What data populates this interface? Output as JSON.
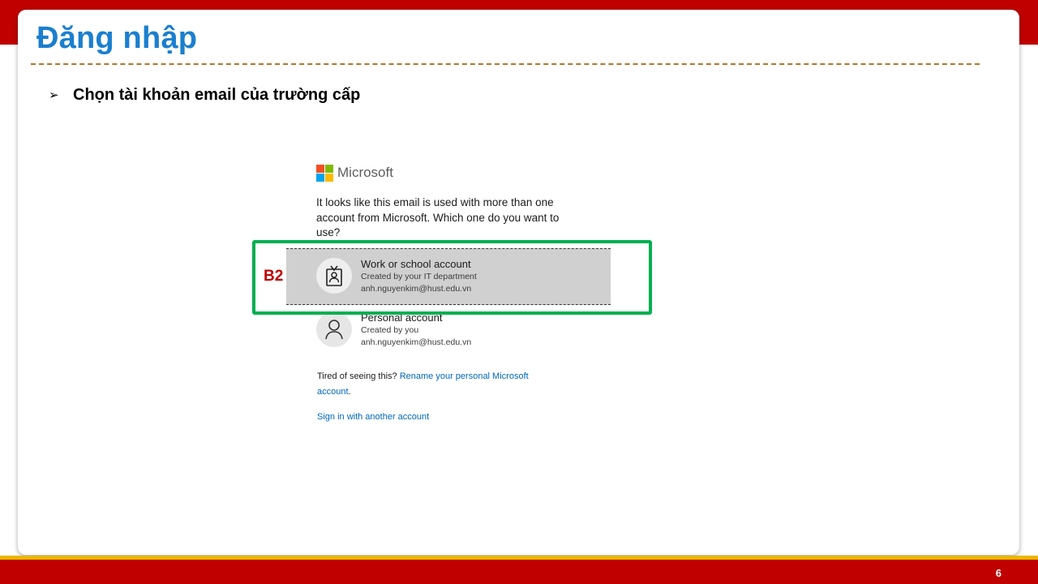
{
  "slide": {
    "title": "Đăng nhập",
    "bullet": "Chọn tài khoản email của trường cấp",
    "page_number": "6",
    "step_label": "B2",
    "colors": {
      "band": "#c00000",
      "title": "#1a7fcf",
      "highlight": "#00b050",
      "accent_line": "#e8b800"
    }
  },
  "microsoft_dialog": {
    "brand": "Microsoft",
    "logo_colors": [
      "#f25022",
      "#7fba00",
      "#00a4ef",
      "#ffb900"
    ],
    "prompt": "It looks like this email is used with more than one account from Microsoft. Which one do you want to use?",
    "accounts": [
      {
        "type": "Work or school account",
        "created_by": "Created by your IT department",
        "email": "anh.nguyenkim@hust.edu.vn",
        "icon": "badge-icon",
        "selected": true
      },
      {
        "type": "Personal account",
        "created_by": "Created by you",
        "email": "anh.nguyenkim@hust.edu.vn",
        "icon": "person-icon",
        "selected": false
      }
    ],
    "tired_text": "Tired of seeing this?",
    "rename_link": "Rename your personal Microsoft account",
    "tired_suffix": ".",
    "signin_another": "Sign in with another account"
  }
}
